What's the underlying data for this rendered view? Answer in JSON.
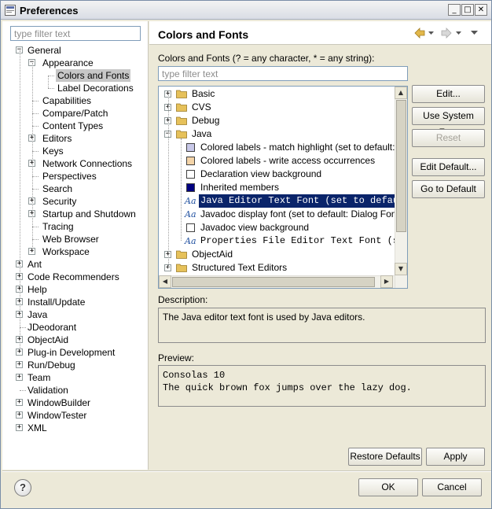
{
  "window": {
    "title": "Preferences"
  },
  "left": {
    "filter_placeholder": "type filter text",
    "tree": [
      {
        "label": "General",
        "level": 0,
        "expander": "-"
      },
      {
        "label": "Appearance",
        "level": 1,
        "expander": "-"
      },
      {
        "label": "Colors and Fonts",
        "level": 2,
        "selected": true
      },
      {
        "label": "Label Decorations",
        "level": 2
      },
      {
        "label": "Capabilities",
        "level": 1
      },
      {
        "label": "Compare/Patch",
        "level": 1
      },
      {
        "label": "Content Types",
        "level": 1
      },
      {
        "label": "Editors",
        "level": 1,
        "expander": "+"
      },
      {
        "label": "Keys",
        "level": 1
      },
      {
        "label": "Network Connections",
        "level": 1,
        "expander": "+"
      },
      {
        "label": "Perspectives",
        "level": 1
      },
      {
        "label": "Search",
        "level": 1
      },
      {
        "label": "Security",
        "level": 1,
        "expander": "+"
      },
      {
        "label": "Startup and Shutdown",
        "level": 1,
        "expander": "+"
      },
      {
        "label": "Tracing",
        "level": 1
      },
      {
        "label": "Web Browser",
        "level": 1
      },
      {
        "label": "Workspace",
        "level": 1,
        "expander": "+"
      },
      {
        "label": "Ant",
        "level": 0,
        "expander": "+"
      },
      {
        "label": "Code Recommenders",
        "level": 0,
        "expander": "+"
      },
      {
        "label": "Help",
        "level": 0,
        "expander": "+"
      },
      {
        "label": "Install/Update",
        "level": 0,
        "expander": "+"
      },
      {
        "label": "Java",
        "level": 0,
        "expander": "+"
      },
      {
        "label": "JDeodorant",
        "level": 0
      },
      {
        "label": "ObjectAid",
        "level": 0,
        "expander": "+"
      },
      {
        "label": "Plug-in Development",
        "level": 0,
        "expander": "+"
      },
      {
        "label": "Run/Debug",
        "level": 0,
        "expander": "+"
      },
      {
        "label": "Team",
        "level": 0,
        "expander": "+"
      },
      {
        "label": "Validation",
        "level": 0
      },
      {
        "label": "WindowBuilder",
        "level": 0,
        "expander": "+"
      },
      {
        "label": "WindowTester",
        "level": 0,
        "expander": "+"
      },
      {
        "label": "XML",
        "level": 0,
        "expander": "+"
      }
    ]
  },
  "right": {
    "title": "Colors and Fonts",
    "nav_icons": [
      "back-arrow-icon",
      "forward-arrow-icon",
      "view-menu-icon"
    ],
    "colors_label": "Colors and Fonts (? = any character, * = any string):",
    "filter_placeholder": "type filter text",
    "tree": [
      {
        "label": "Basic",
        "kind": "folder",
        "level": 0,
        "expander": "+"
      },
      {
        "label": "CVS",
        "kind": "folder",
        "level": 0,
        "expander": "+"
      },
      {
        "label": "Debug",
        "kind": "folder",
        "level": 0,
        "expander": "+"
      },
      {
        "label": "Java",
        "kind": "folder",
        "level": 0,
        "expander": "-"
      },
      {
        "label": "Colored labels - match highlight (set to default: M",
        "kind": "color",
        "color": "#c8c8e8",
        "level": 1
      },
      {
        "label": "Colored labels - write access occurrences",
        "kind": "color",
        "color": "#f4d4a8",
        "level": 1
      },
      {
        "label": "Declaration view background",
        "kind": "color",
        "color": "#ffffff",
        "level": 1
      },
      {
        "label": "Inherited members",
        "kind": "color",
        "color": "#000080",
        "level": 1
      },
      {
        "label": "Java Editor Text Font (set to default: ",
        "kind": "font",
        "mono": true,
        "level": 1,
        "selected": true
      },
      {
        "label": "Javadoc display font (set to default: Dialog Font)",
        "kind": "font",
        "level": 1
      },
      {
        "label": "Javadoc view background",
        "kind": "color",
        "color": "#ffffff",
        "level": 1
      },
      {
        "label": "Properties File Editor Text Font (set to",
        "kind": "font",
        "mono": true,
        "level": 1
      },
      {
        "label": "ObjectAid",
        "kind": "folder",
        "level": 0,
        "expander": "+"
      },
      {
        "label": "Structured Text Editors",
        "kind": "folder",
        "level": 0,
        "expander": "+"
      }
    ],
    "buttons": {
      "edit": "Edit...",
      "use_system_font": "Use System Font",
      "reset": "Reset",
      "edit_default": "Edit Default...",
      "go_to_default": "Go to Default"
    },
    "description_label": "Description:",
    "description_text": "The Java editor text font is used by Java editors.",
    "preview_label": "Preview:",
    "preview_lines": [
      "Consolas 10",
      "The quick brown fox jumps over the lazy dog."
    ],
    "restore_defaults": "Restore Defaults",
    "apply": "Apply"
  },
  "footer": {
    "help_icon": "help-icon",
    "help_glyph": "?",
    "ok": "OK",
    "cancel": "Cancel"
  },
  "colors": {
    "selection": "#0a246a",
    "folder": "#e6c15a",
    "font_glyph": "#2050a0"
  }
}
